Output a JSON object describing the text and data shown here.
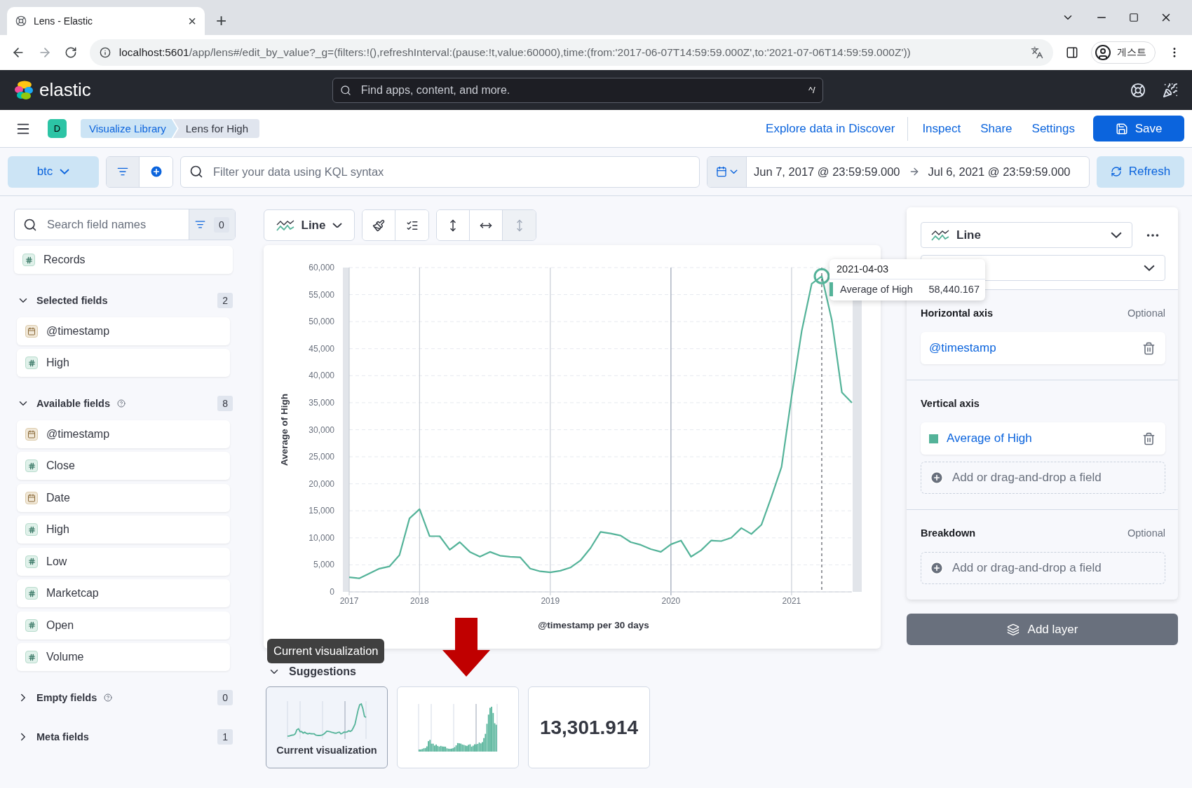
{
  "browser": {
    "tab": {
      "title": "Lens - Elastic",
      "close": "×"
    },
    "new_tab": "+",
    "url_host": "localhost:5601",
    "url_rest": "/app/lens#/edit_by_value?_g=(filters:!(),refreshInterval:(pause:!t,value:60000),time:(from:'2017-06-07T14:59:59.000Z',to:'2021-07-06T14:59:59.000Z'))",
    "profile": "게스트"
  },
  "header": {
    "brand": "elastic",
    "search": {
      "placeholder": "Find apps, content, and more."
    },
    "shortcut": "^/"
  },
  "nav": {
    "space": "D",
    "breadcrumbs": [
      {
        "label": "Visualize Library",
        "selected": false
      },
      {
        "label": "Lens for High",
        "selected": true
      }
    ],
    "links": [
      "Explore data in Discover",
      "Inspect",
      "Share",
      "Settings"
    ],
    "save": "Save"
  },
  "query": {
    "data_view": "btc",
    "search": {
      "placeholder": "Filter your data using KQL syntax"
    },
    "start": "Jun 7, 2017 @ 23:59:59.000",
    "end": "Jul 6, 2021 @ 23:59:59.000",
    "refresh": "Refresh"
  },
  "fields": {
    "search": {
      "placeholder": "Search field names"
    },
    "filter_count": "0",
    "records": {
      "name": "Records",
      "kind": "number"
    },
    "groups": [
      {
        "title": "Selected fields",
        "count": "2",
        "expanded": true,
        "help": false,
        "items": [
          {
            "name": "@timestamp",
            "kind": "date"
          },
          {
            "name": "High",
            "kind": "number"
          }
        ]
      },
      {
        "title": "Available fields",
        "count": "8",
        "expanded": true,
        "help": true,
        "items": [
          {
            "name": "@timestamp",
            "kind": "date"
          },
          {
            "name": "Close",
            "kind": "number"
          },
          {
            "name": "Date",
            "kind": "date"
          },
          {
            "name": "High",
            "kind": "number"
          },
          {
            "name": "Low",
            "kind": "number"
          },
          {
            "name": "Marketcap",
            "kind": "number"
          },
          {
            "name": "Open",
            "kind": "number"
          },
          {
            "name": "Volume",
            "kind": "number"
          }
        ]
      },
      {
        "title": "Empty fields",
        "count": "0",
        "expanded": false,
        "help": true
      },
      {
        "title": "Meta fields",
        "count": "1",
        "expanded": false,
        "help": false
      }
    ]
  },
  "workspace": {
    "chart_type": "Line",
    "toolbar": [
      {
        "kind": "style",
        "disabled": false
      },
      {
        "kind": "legend",
        "disabled": false
      },
      {
        "kind": "left_axis",
        "disabled": false
      },
      {
        "kind": "bottom_axis",
        "disabled": false
      },
      {
        "kind": "right_axis",
        "disabled": true
      }
    ],
    "chart_data": {
      "type": "line",
      "xlabel": "@timestamp per 30 days",
      "ylabel": "Average of High",
      "categories": [
        "2017",
        null,
        null,
        null,
        null,
        null,
        null,
        "2018",
        null,
        null,
        null,
        null,
        null,
        null,
        null,
        null,
        null,
        null,
        null,
        null,
        "2019",
        null,
        null,
        null,
        null,
        null,
        null,
        null,
        null,
        null,
        null,
        null,
        "2020",
        null,
        null,
        null,
        null,
        null,
        null,
        null,
        null,
        null,
        null,
        null,
        "2021",
        null,
        null,
        null,
        null,
        null,
        null
      ],
      "series": [
        {
          "name": "Average of High",
          "color": "#54b399",
          "values": [
            2700,
            2500,
            3400,
            4300,
            4700,
            6800,
            13600,
            15300,
            10300,
            10300,
            7800,
            9200,
            7400,
            6500,
            7400,
            6700,
            6500,
            6400,
            4300,
            3800,
            3600,
            3900,
            4500,
            5800,
            8100,
            11100,
            10800,
            10400,
            9200,
            8700,
            7900,
            7400,
            8800,
            9500,
            6500,
            7700,
            9500,
            9400,
            10000,
            11800,
            10700,
            12400,
            17600,
            23100,
            36200,
            48200,
            57000,
            58400,
            50300,
            36900,
            35000
          ]
        }
      ],
      "ylim": [
        0,
        60000
      ],
      "grid": true,
      "yticks": [
        {
          "value": 0,
          "label": "0"
        },
        {
          "value": 5000,
          "label": "5,000"
        },
        {
          "value": 10000,
          "label": "10,000"
        },
        {
          "value": 15000,
          "label": "15,000"
        },
        {
          "value": 20000,
          "label": "20,000"
        },
        {
          "value": 25000,
          "label": "25,000"
        },
        {
          "value": 30000,
          "label": "30,000"
        },
        {
          "value": 35000,
          "label": "35,000"
        },
        {
          "value": 40000,
          "label": "40,000"
        },
        {
          "value": 45000,
          "label": "45,000"
        },
        {
          "value": 50000,
          "label": "50,000"
        },
        {
          "value": 55000,
          "label": "55,000"
        },
        {
          "value": 60000,
          "label": "60,000"
        }
      ]
    },
    "tooltip": {
      "date": "2021-04-03",
      "value": "58,440.167"
    }
  },
  "suggestions": {
    "title": "Suggestions",
    "hint": "Current visualization",
    "items": [
      {
        "kind": "line",
        "label": "Current visualization",
        "selected": true
      },
      {
        "kind": "bar",
        "selected": false
      },
      {
        "kind": "metric",
        "value": "13,301.914",
        "selected": false
      }
    ]
  },
  "config": {
    "chart_type": "Line",
    "sections": [
      {
        "title": "Horizontal axis",
        "optional": "Optional",
        "items": [
          {
            "kind": "field",
            "label": "@timestamp"
          }
        ]
      },
      {
        "title": "Vertical axis",
        "items": [
          {
            "kind": "field",
            "label": "Average of High",
            "color": "#54b399"
          },
          {
            "kind": "add",
            "label": "Add or drag-and-drop a field"
          }
        ]
      },
      {
        "title": "Breakdown",
        "optional": "Optional",
        "items": [
          {
            "kind": "add",
            "label": "Add or drag-and-drop a field"
          }
        ]
      }
    ],
    "add_layer": "Add layer"
  }
}
